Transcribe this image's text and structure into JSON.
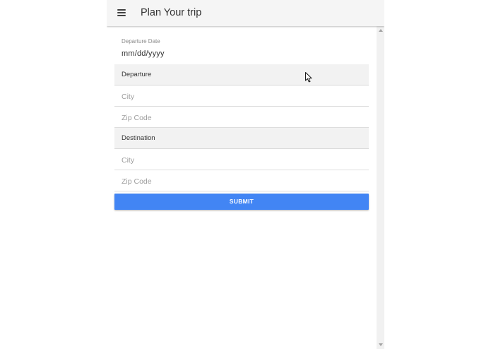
{
  "header": {
    "title": "Plan Your trip",
    "menu_icon": "hamburger-menu-icon"
  },
  "form": {
    "departure_date": {
      "label": "Departure Date",
      "value": "mm/dd/yyyy"
    },
    "departure": {
      "section_label": "Departure",
      "city_placeholder": "City",
      "zip_placeholder": "Zip Code"
    },
    "destination": {
      "section_label": "Destination",
      "city_placeholder": "City",
      "zip_placeholder": "Zip Code"
    },
    "submit_label": "SUBMIT"
  },
  "colors": {
    "appbar": "#f5f5f5",
    "section_bg": "#f2f2f2",
    "accent": "#4285f4"
  }
}
